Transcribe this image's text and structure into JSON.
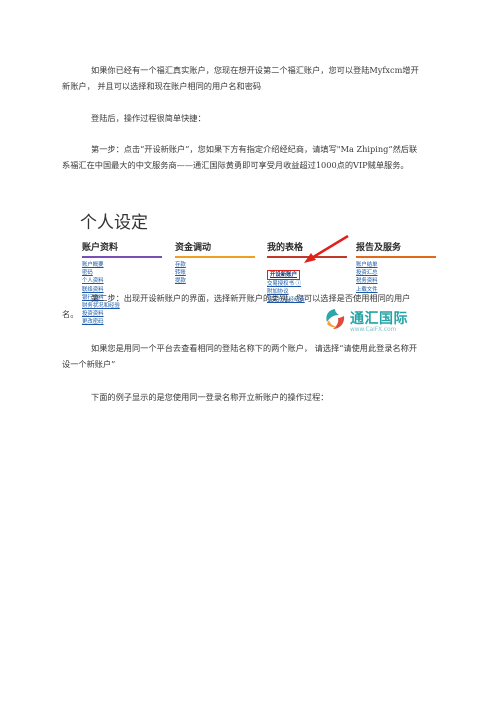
{
  "paragraphs": {
    "intro": "如果你已经有一个福汇真实账户，您现在想开设第二个福汇账户，您可以登陆Myfxcm增开新账户， 并且可以选择和现在账户相同的用户名和密码",
    "after_login": "登陆后，操作过程很简单快捷：",
    "step1": "第一步：点击“开设新账户”，您如果下方有指定介绍经纪商，请填写\"Ma Zhiping“然后联系福汇在中国最大的中文服务商——通汇国际黄勇即可享受月收益超过1000点的VIP贼单服务。",
    "step2": "第二步：出现开设新账户的界面，选择新开账户的类别。您可以选择是否使用相同的用户名。",
    "same_login": "如果您是用同一个平台去查看相同的登陆名称下的两个账户， 请选择“请使用此登录名称开设一个新账户”",
    "example": "下面的例子显示的是您使用同一登录名称开立新账户的操作过程："
  },
  "screenshot": {
    "title": "个人设定",
    "columns": [
      {
        "header": "账户资料",
        "items": [
          "账户概要",
          "密码",
          "个人资料",
          "联络资料",
          "银行资料",
          "财务状况和经验",
          "投资资料",
          "更改密码"
        ]
      },
      {
        "header": "资金调动",
        "items": [
          "存款",
          "转账",
          "提款"
        ]
      },
      {
        "header": "我的表格",
        "items": [
          "开设新账户",
          "交易授权书 ⓘ",
          "附加协议",
          "指定介绍经纪商"
        ]
      },
      {
        "header": "报告及服务",
        "items": [
          "账户结单",
          "投资汇总",
          "税务资料",
          "上载文件"
        ]
      }
    ],
    "watermark_name": "通汇国际",
    "watermark_url": "www.CaiFX.com"
  },
  "colors": {
    "link": "#1a57a8",
    "highlight_box": "#e0201a",
    "logo_teal": "#26a3a6"
  }
}
